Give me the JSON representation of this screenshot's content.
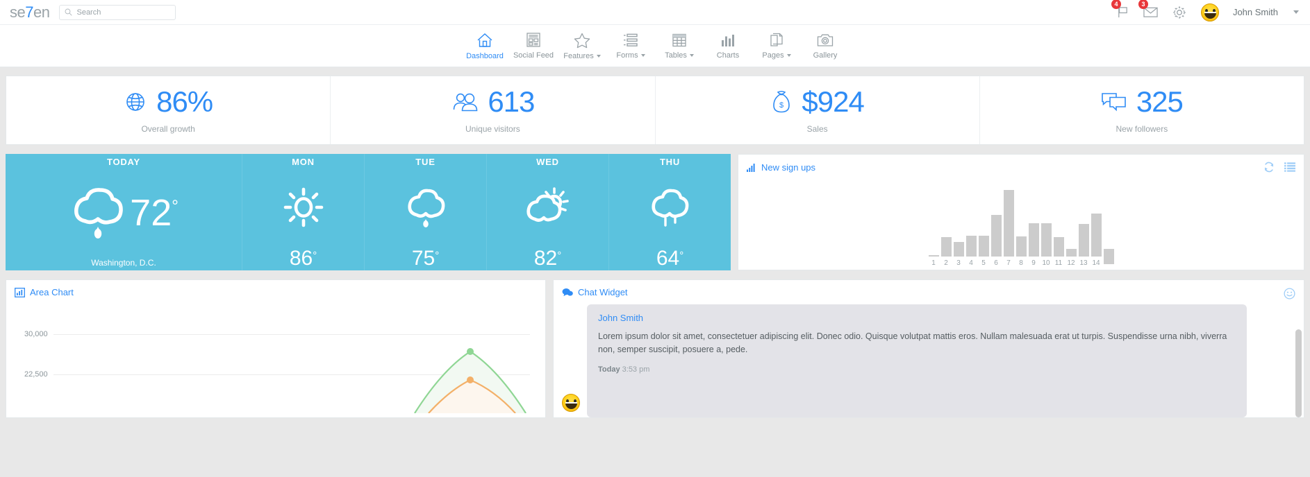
{
  "brand": {
    "prefix": "se",
    "accent": "7",
    "suffix": "en",
    "accent_color": "#2f8cf5"
  },
  "search": {
    "placeholder": "Search",
    "value": "",
    "icon": "search-icon"
  },
  "header": {
    "flag": {
      "icon": "flag-icon",
      "badge": "4"
    },
    "mail": {
      "icon": "envelope-icon",
      "badge": "3"
    },
    "settings": {
      "icon": "gear-icon"
    },
    "user": {
      "name": "John Smith",
      "avatar": "avatar-emoji"
    }
  },
  "nav": {
    "items": [
      {
        "label": "Dashboard",
        "icon": "home-icon",
        "active": true,
        "caret": false
      },
      {
        "label": "Social Feed",
        "icon": "layout-icon",
        "active": false,
        "caret": false
      },
      {
        "label": "Features",
        "icon": "star-icon",
        "active": false,
        "caret": true
      },
      {
        "label": "Forms",
        "icon": "list-icon",
        "active": false,
        "caret": true
      },
      {
        "label": "Tables",
        "icon": "table-icon",
        "active": false,
        "caret": true
      },
      {
        "label": "Charts",
        "icon": "bar-chart-icon",
        "active": false,
        "caret": false
      },
      {
        "label": "Pages",
        "icon": "pages-icon",
        "active": false,
        "caret": true
      },
      {
        "label": "Gallery",
        "icon": "camera-icon",
        "active": false,
        "caret": false
      }
    ]
  },
  "stats": [
    {
      "icon": "globe-icon",
      "value": "86%",
      "label": "Overall growth"
    },
    {
      "icon": "users-icon",
      "value": "613",
      "label": "Unique visitors"
    },
    {
      "icon": "moneybag-icon",
      "value": "$924",
      "label": "Sales"
    },
    {
      "icon": "comments-icon",
      "value": "325",
      "label": "New followers"
    }
  ],
  "weather": {
    "panel_color": "#5bc2de",
    "days": [
      {
        "name": "TODAY",
        "icon": "cloud-rain-icon",
        "temp": "72",
        "deg": "°",
        "city": "Washington, D.C."
      },
      {
        "name": "MON",
        "icon": "sun-icon",
        "temp": "86",
        "deg": "°",
        "city": ""
      },
      {
        "name": "TUE",
        "icon": "cloud-rain-icon",
        "temp": "75",
        "deg": "°",
        "city": ""
      },
      {
        "name": "WED",
        "icon": "sun-cloud-icon",
        "temp": "82",
        "deg": "°",
        "city": ""
      },
      {
        "name": "THU",
        "icon": "cloud-drizzle-icon",
        "temp": "64",
        "deg": "°",
        "city": ""
      }
    ]
  },
  "signups": {
    "title": "New sign ups",
    "icon": "signal-bars-icon",
    "tools": [
      "refresh-icon",
      "list-icon"
    ],
    "chart_data": {
      "type": "bar",
      "title": "New sign ups",
      "categories": [
        "1",
        "2",
        "3",
        "4",
        "5",
        "6",
        "7",
        "8",
        "9",
        "10",
        "11",
        "12",
        "13",
        "14"
      ],
      "values": [
        1,
        28,
        21,
        30,
        30,
        60,
        96,
        29,
        48,
        48,
        28,
        11,
        47,
        62,
        22
      ],
      "xlabel": "",
      "ylabel": "",
      "ylim": [
        0,
        100
      ],
      "grid": false,
      "legend": "none",
      "bar_color": "#cccccc"
    }
  },
  "area_chart": {
    "title": "Area Chart",
    "icon": "bar-chart-icon",
    "chart_data": {
      "type": "area",
      "title": "Area Chart",
      "ylabel": "",
      "xlabel": "",
      "yticks": [
        "30,000",
        "22,500"
      ],
      "ytick_values": [
        30000,
        22500
      ],
      "ylim": [
        0,
        32000
      ],
      "grid": true,
      "legend": "none",
      "series": [
        {
          "name": "series-green",
          "color": "#8fd694",
          "peak_value": 26200,
          "peak_x": 0.81
        },
        {
          "name": "series-orange",
          "color": "#f3b068",
          "peak_value": 21500,
          "peak_x": 0.81
        }
      ]
    }
  },
  "chat": {
    "title": "Chat Widget",
    "icon": "chat-icon",
    "tool_icon": "smiley-icon",
    "messages": [
      {
        "author": "John Smith",
        "text": "Lorem ipsum dolor sit amet, consectetuer adipiscing elit. Donec odio. Quisque volutpat mattis eros. Nullam malesuada erat ut turpis. Suspendisse urna nibh, viverra non, semper suscipit, posuere a, pede.",
        "time_label": "Today",
        "time_value": "3:53 pm",
        "avatar": "avatar-emoji"
      }
    ]
  }
}
